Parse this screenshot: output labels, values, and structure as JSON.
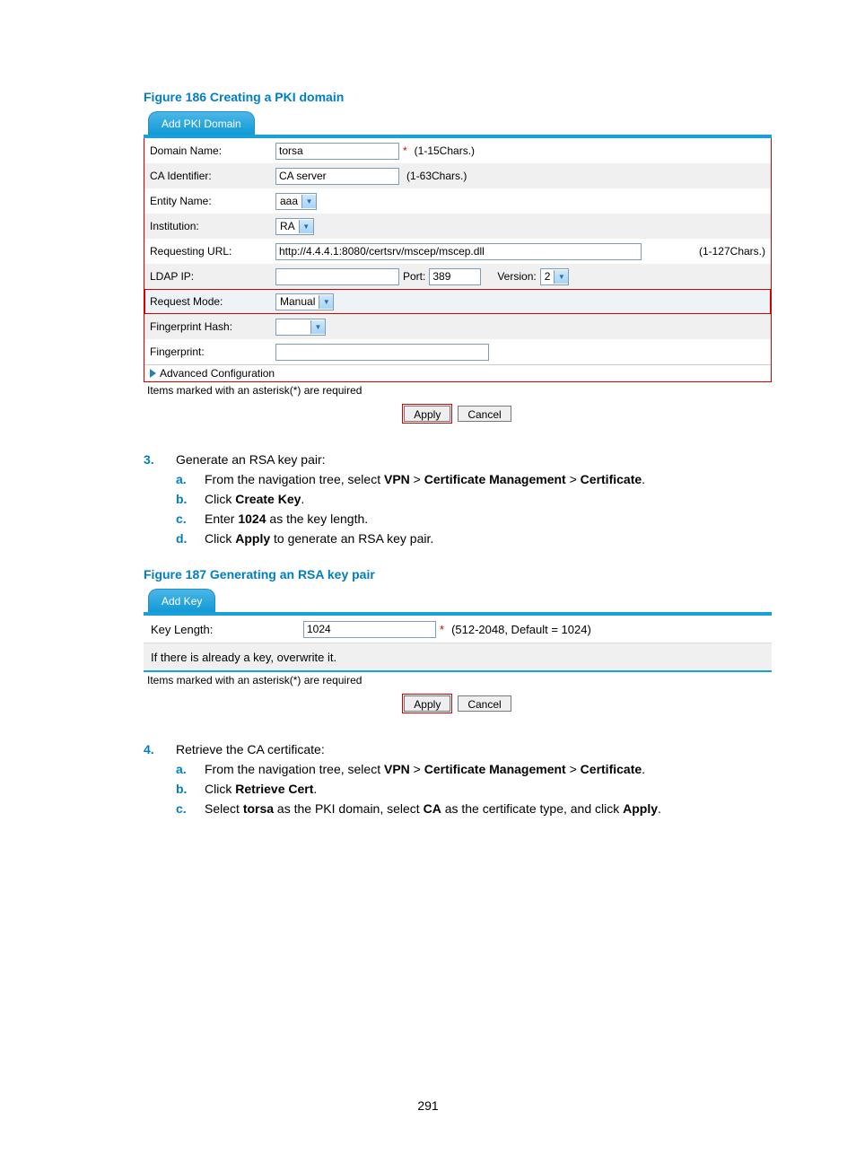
{
  "figure186": {
    "caption": "Figure 186 Creating a PKI domain",
    "tab": "Add PKI Domain",
    "rows": {
      "domain_name": {
        "label": "Domain Name:",
        "value": "torsa",
        "hint": "(1-15Chars.)"
      },
      "ca_identifier": {
        "label": "CA Identifier:",
        "value": "CA server",
        "hint": "(1-63Chars.)"
      },
      "entity_name": {
        "label": "Entity Name:",
        "value": "aaa"
      },
      "institution": {
        "label": "Institution:",
        "value": "RA"
      },
      "requesting_url": {
        "label": "Requesting URL:",
        "value": "http://4.4.4.1:8080/certsrv/mscep/mscep.dll",
        "hint": "(1-127Chars.)"
      },
      "ldap_ip": {
        "label": "LDAP IP:",
        "port_label": "Port:",
        "port": "389",
        "version_label": "Version:",
        "version": "2"
      },
      "request_mode": {
        "label": "Request Mode:",
        "value": "Manual"
      },
      "fp_hash": {
        "label": "Fingerprint Hash:"
      },
      "fingerprint": {
        "label": "Fingerprint:"
      }
    },
    "advanced": "Advanced Configuration",
    "note": "Items marked with an asterisk(*) are required",
    "buttons": {
      "apply": "Apply",
      "cancel": "Cancel"
    }
  },
  "step3": {
    "num": "3.",
    "lead": "Generate an RSA key pair:",
    "a": {
      "pre": "From the navigation tree, select ",
      "b1": "VPN",
      "gt1": " > ",
      "b2": "Certificate Management",
      "gt2": " > ",
      "b3": "Certificate",
      "post": "."
    },
    "b": {
      "pre": "Click ",
      "bold": "Create Key",
      "post": "."
    },
    "c": {
      "pre": "Enter ",
      "bold": "1024",
      "post": " as the key length."
    },
    "d": {
      "pre": "Click ",
      "bold": "Apply",
      "post": " to generate an RSA key pair."
    }
  },
  "figure187": {
    "caption": "Figure 187 Generating an RSA key pair",
    "tab": "Add Key",
    "key_length_label": "Key Length:",
    "key_length_value": "1024",
    "key_length_hint": "(512-2048, Default = 1024)",
    "overwrite": "If there is already a key, overwrite it.",
    "note": "Items marked with an asterisk(*) are required",
    "buttons": {
      "apply": "Apply",
      "cancel": "Cancel"
    }
  },
  "step4": {
    "num": "4.",
    "lead": "Retrieve the CA certificate:",
    "a": {
      "pre": "From the navigation tree, select ",
      "b1": "VPN",
      "gt1": " > ",
      "b2": "Certificate Management",
      "gt2": " > ",
      "b3": "Certificate",
      "post": "."
    },
    "b": {
      "pre": "Click ",
      "bold": "Retrieve Cert",
      "post": "."
    },
    "c": {
      "pre": "Select ",
      "b1": "torsa",
      "mid1": " as the PKI domain, select ",
      "b2": "CA",
      "mid2": " as the certificate type, and click ",
      "b3": "Apply",
      "post": "."
    }
  },
  "page_number": "291"
}
